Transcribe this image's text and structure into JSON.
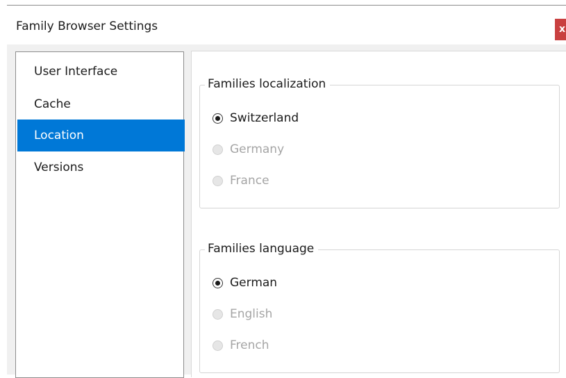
{
  "window": {
    "title": "Family Browser Settings",
    "close_label": "x"
  },
  "nav": {
    "items": [
      {
        "label": "User Interface",
        "selected": false
      },
      {
        "label": "Cache",
        "selected": false
      },
      {
        "label": "Location",
        "selected": true
      },
      {
        "label": "Versions",
        "selected": false
      }
    ]
  },
  "localization": {
    "title": "Families localization",
    "options": [
      {
        "label": "Switzerland",
        "checked": true,
        "enabled": true
      },
      {
        "label": "Germany",
        "checked": false,
        "enabled": false
      },
      {
        "label": "France",
        "checked": false,
        "enabled": false
      }
    ]
  },
  "language": {
    "title": "Families language",
    "options": [
      {
        "label": "German",
        "checked": true,
        "enabled": true
      },
      {
        "label": "English",
        "checked": false,
        "enabled": false
      },
      {
        "label": "French",
        "checked": false,
        "enabled": false
      }
    ]
  },
  "colors": {
    "selection": "#0078d7",
    "close": "#c94040",
    "disabled_text": "#a5a5a5"
  }
}
